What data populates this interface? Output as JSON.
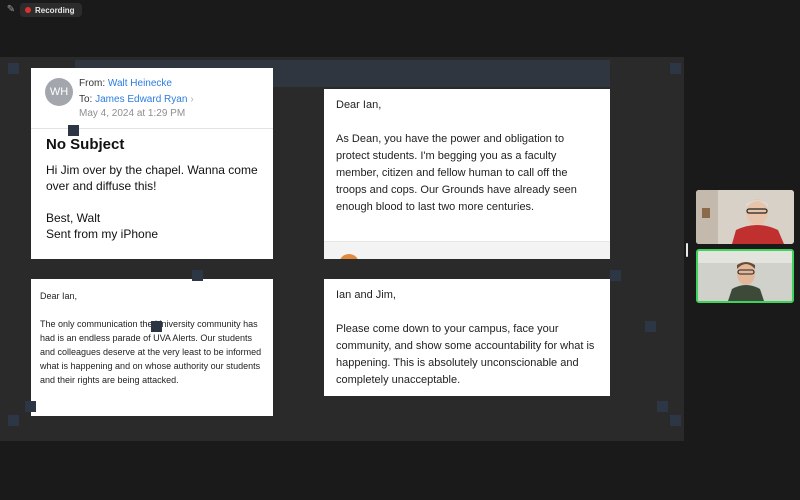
{
  "topbar": {
    "recording_label": "Recording"
  },
  "email": {
    "from_label": "From:",
    "from_name": "Walt Heinecke",
    "avatar_initials": "WH",
    "to_label": "To:",
    "to_name": "James Edward Ryan",
    "date": "May 4, 2024 at 1:29 PM",
    "subject": "No Subject",
    "body": [
      "Hi Jim over by the chapel. Wanna come over and diffuse this!",
      "Best, Walt",
      "Sent from my iPhone"
    ]
  },
  "letter_dean": {
    "greeting": "Dear Ian,",
    "body": "As Dean, you have the power and obligation to protect students. I'm begging you as a faculty member, citizen and fellow human to call off the troops and cops. Our Grounds have already seen enough blood to last two more centuries."
  },
  "letter_uva_alerts": {
    "greeting": "Dear Ian,",
    "body": "The only communication the University community has had is an endless parade of UVA Alerts. Our students and colleagues deserve at the very least to be informed what is happening and on whose authority our students and their rights are being attacked."
  },
  "letter_come_down": {
    "greeting": "Ian and Jim,",
    "body": "Please come down to your campus, face your community, and show some accountability for what is happening. This is absolutely unconscionable and completely unacceptable."
  },
  "participants": [
    {
      "icon": "participant-video-icon"
    },
    {
      "icon": "participant-video-icon",
      "active_speaker_color": "#3ed35a"
    }
  ],
  "colors": {
    "recording": "#e02f2f",
    "link": "#2b7de1",
    "active_speaker": "#3ed35a"
  }
}
